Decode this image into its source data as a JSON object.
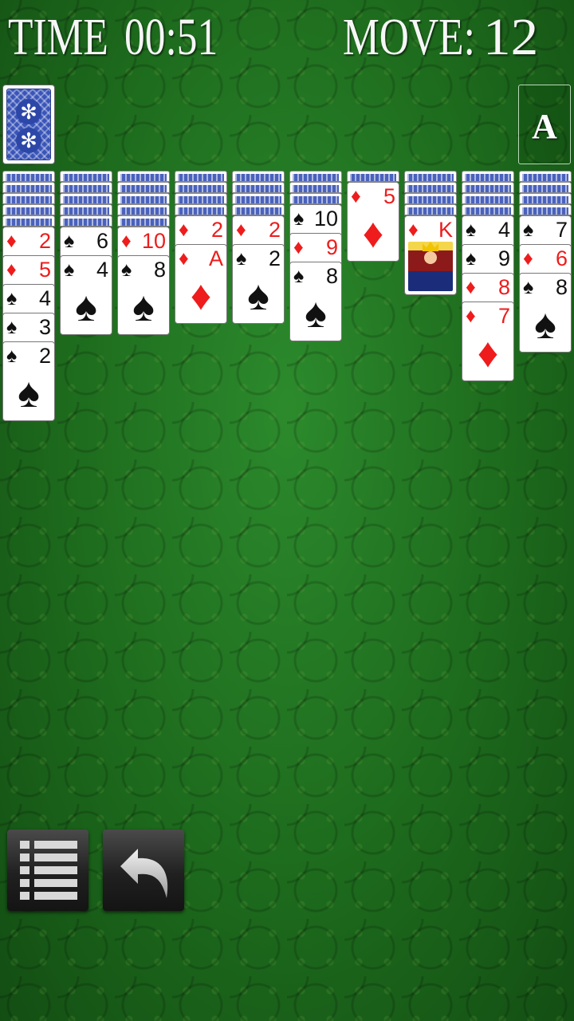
{
  "hud": {
    "time_label": "TIME",
    "time_value": "00:51",
    "move_label": "MOVE:",
    "move_value": "12"
  },
  "foundation": {
    "label": "A"
  },
  "colors": {
    "felt": "#1f6e1f",
    "red_suit": "#ee1c1c",
    "black_suit": "#111111",
    "card_back": "#3a55b8"
  },
  "columns": [
    {
      "hidden": 5,
      "cards": [
        {
          "rank": "2",
          "suit": "diamond"
        },
        {
          "rank": "5",
          "suit": "diamond"
        },
        {
          "rank": "4",
          "suit": "spade"
        },
        {
          "rank": "3",
          "suit": "spade"
        },
        {
          "rank": "2",
          "suit": "spade"
        }
      ]
    },
    {
      "hidden": 5,
      "cards": [
        {
          "rank": "6",
          "suit": "spade"
        },
        {
          "rank": "4",
          "suit": "spade"
        }
      ]
    },
    {
      "hidden": 5,
      "cards": [
        {
          "rank": "10",
          "suit": "diamond"
        },
        {
          "rank": "8",
          "suit": "spade"
        }
      ]
    },
    {
      "hidden": 4,
      "cards": [
        {
          "rank": "2",
          "suit": "diamond"
        },
        {
          "rank": "A",
          "suit": "diamond"
        }
      ]
    },
    {
      "hidden": 4,
      "cards": [
        {
          "rank": "2",
          "suit": "diamond"
        },
        {
          "rank": "2",
          "suit": "spade"
        }
      ]
    },
    {
      "hidden": 3,
      "cards": [
        {
          "rank": "10",
          "suit": "spade"
        },
        {
          "rank": "9",
          "suit": "diamond"
        },
        {
          "rank": "8",
          "suit": "spade"
        }
      ]
    },
    {
      "hidden": 1,
      "cards": [
        {
          "rank": "5",
          "suit": "diamond"
        }
      ]
    },
    {
      "hidden": 4,
      "cards": [
        {
          "rank": "K",
          "suit": "diamond",
          "face": "king"
        }
      ]
    },
    {
      "hidden": 4,
      "cards": [
        {
          "rank": "4",
          "suit": "spade"
        },
        {
          "rank": "9",
          "suit": "spade"
        },
        {
          "rank": "8",
          "suit": "diamond"
        },
        {
          "rank": "7",
          "suit": "diamond"
        }
      ]
    },
    {
      "hidden": 4,
      "cards": [
        {
          "rank": "7",
          "suit": "spade"
        },
        {
          "rank": "6",
          "suit": "diamond"
        },
        {
          "rank": "8",
          "suit": "spade"
        }
      ]
    }
  ],
  "buttons": {
    "menu": "menu-icon",
    "undo": "undo-icon"
  }
}
